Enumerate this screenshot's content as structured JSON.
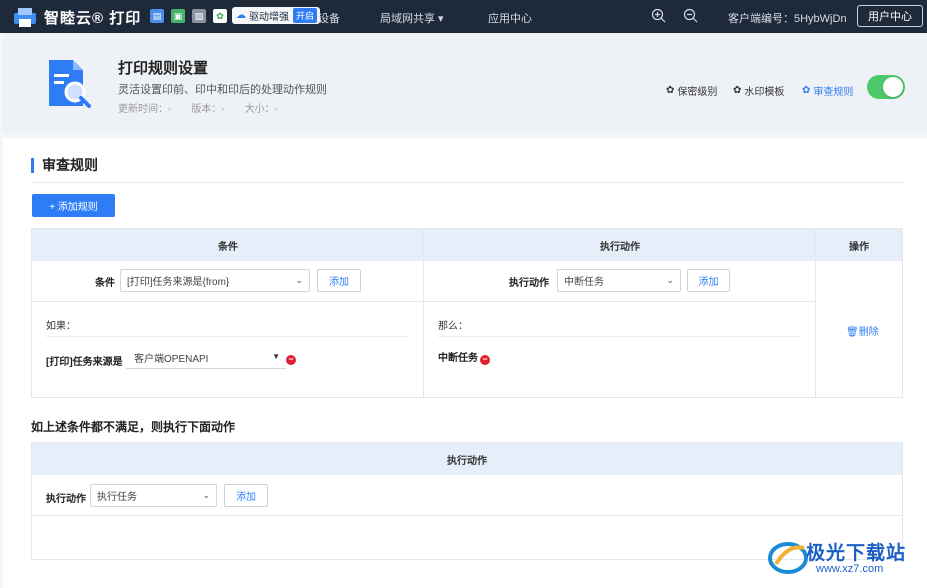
{
  "topbar": {
    "app_name": "智睦云® 打印",
    "driver_label": "驱动增强",
    "driver_badge": "开启",
    "device_partial": "设备",
    "nav": [
      "局域网共享 ▾",
      "应用中心"
    ],
    "client_label": "客户端编号：",
    "client_id": "5HybWjDn",
    "user_center": "用户中心"
  },
  "header": {
    "title": "打印规则设置",
    "description": "灵活设置印前、印中和印后的处理动作规则",
    "update_time": "更新时间：-",
    "version": "版本：-",
    "size": "大小：-",
    "links": [
      "保密级别",
      "水印模板",
      "审查规则"
    ],
    "toggle_on": true,
    "accent": "#2f7df6",
    "toggle_color": "#4cc96a"
  },
  "section": {
    "title": "审查规则",
    "add_rule": "+ 添加规则"
  },
  "rules_table": {
    "col_condition": "条件",
    "col_action": "执行动作",
    "col_ops": "操作",
    "cond_label": "条件",
    "cond_select": "[打印]任务来源是{from}",
    "cond_add": "添加",
    "action_label": "执行动作",
    "action_select": "中断任务",
    "action_add": "添加",
    "if_text": "如果：",
    "then_text": "那么：",
    "cond_item_label": "[打印]任务来源是",
    "cond_item_value": "客户端OPENAPI",
    "action_item": "中断任务",
    "delete": "删除"
  },
  "fallback": {
    "title": "如上述条件都不满足，则执行下面动作",
    "col_action": "执行动作",
    "action_label": "执行动作",
    "action_select": "执行任务",
    "action_add": "添加"
  },
  "watermark": {
    "text": "极光下载站",
    "url": "www.xz7.com"
  }
}
